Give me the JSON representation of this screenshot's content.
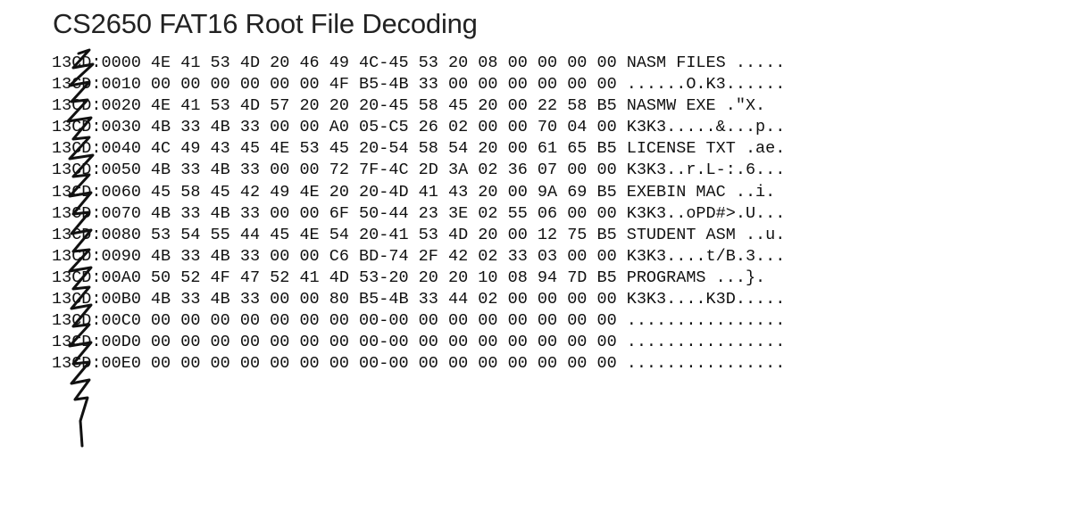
{
  "title": "CS2650 FAT16 Root File Decoding",
  "rows": [
    {
      "addr": "13CD:0000",
      "hex": "4E 41 53 4D 20 46 49 4C-45 53 20 08 00 00 00 00",
      "ascii": "NASM FILES ....."
    },
    {
      "addr": "13CD:0010",
      "hex": "00 00 00 00 00 00 4F B5-4B 33 00 00 00 00 00 00",
      "ascii": "......O.K3......"
    },
    {
      "addr": "13CD:0020",
      "hex": "4E 41 53 4D 57 20 20 20-45 58 45 20 00 22 58 B5",
      "ascii": "NASMW EXE .\"X."
    },
    {
      "addr": "13CD:0030",
      "hex": "4B 33 4B 33 00 00 A0 05-C5 26 02 00 00 70 04 00",
      "ascii": "K3K3.....&...p.."
    },
    {
      "addr": "13CD:0040",
      "hex": "4C 49 43 45 4E 53 45 20-54 58 54 20 00 61 65 B5",
      "ascii": "LICENSE TXT .ae."
    },
    {
      "addr": "13CD:0050",
      "hex": "4B 33 4B 33 00 00 72 7F-4C 2D 3A 02 36 07 00 00",
      "ascii": "K3K3..r.L-:.6..."
    },
    {
      "addr": "13CD:0060",
      "hex": "45 58 45 42 49 4E 20 20-4D 41 43 20 00 9A 69 B5",
      "ascii": "EXEBIN MAC ..i."
    },
    {
      "addr": "13CD:0070",
      "hex": "4B 33 4B 33 00 00 6F 50-44 23 3E 02 55 06 00 00",
      "ascii": "K3K3..oPD#>.U..."
    },
    {
      "addr": "13CD:0080",
      "hex": "53 54 55 44 45 4E 54 20-41 53 4D 20 00 12 75 B5",
      "ascii": "STUDENT ASM ..u."
    },
    {
      "addr": "13CD:0090",
      "hex": "4B 33 4B 33 00 00 C6 BD-74 2F 42 02 33 03 00 00",
      "ascii": "K3K3....t/B.3..."
    },
    {
      "addr": "13CD:00A0",
      "hex": "50 52 4F 47 52 41 4D 53-20 20 20 10 08 94 7D B5",
      "ascii": "PROGRAMS ...}."
    },
    {
      "addr": "13CD:00B0",
      "hex": "4B 33 4B 33 00 00 80 B5-4B 33 44 02 00 00 00 00",
      "ascii": "K3K3....K3D....."
    },
    {
      "addr": "13CD:00C0",
      "hex": "00 00 00 00 00 00 00 00-00 00 00 00 00 00 00 00",
      "ascii": "................"
    },
    {
      "addr": "13CD:00D0",
      "hex": "00 00 00 00 00 00 00 00-00 00 00 00 00 00 00 00",
      "ascii": "................"
    },
    {
      "addr": "13CD:00E0",
      "hex": "00 00 00 00 00 00 00 00-00 00 00 00 00 00 00 00",
      "ascii": "................"
    }
  ]
}
